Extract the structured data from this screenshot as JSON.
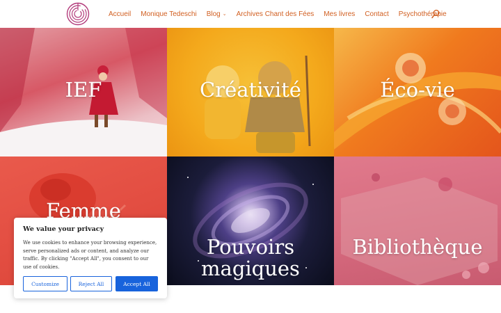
{
  "header": {
    "logo_icon": "labyrinth-logo",
    "nav": [
      {
        "label": "Accueil"
      },
      {
        "label": "Monique Tedeschi"
      },
      {
        "label": "Blog",
        "has_dropdown": true
      },
      {
        "label": "Archives Chant des Fées"
      },
      {
        "label": "Mes livres"
      },
      {
        "label": "Contact"
      },
      {
        "label": "Psychothérapie"
      }
    ],
    "search_icon": "search-icon",
    "accent_color": "#d15f21"
  },
  "tiles": [
    {
      "label": "IEF"
    },
    {
      "label": "Créativité"
    },
    {
      "label": "Éco-vie"
    },
    {
      "label": "Femme"
    },
    {
      "label": "Pouvoirs magiques",
      "line1": "Pouvoirs",
      "line2": "magiques"
    },
    {
      "label": "Bibliothèque"
    }
  ],
  "cookie": {
    "title": "We value your privacy",
    "text": "We use cookies to enhance your browsing experience, serve personalized ads or content, and analyze our traffic. By clicking \"Accept All\", you consent to our use of cookies.",
    "customize": "Customize",
    "reject": "Reject All",
    "accept": "Accept All",
    "button_color": "#1863dc"
  }
}
